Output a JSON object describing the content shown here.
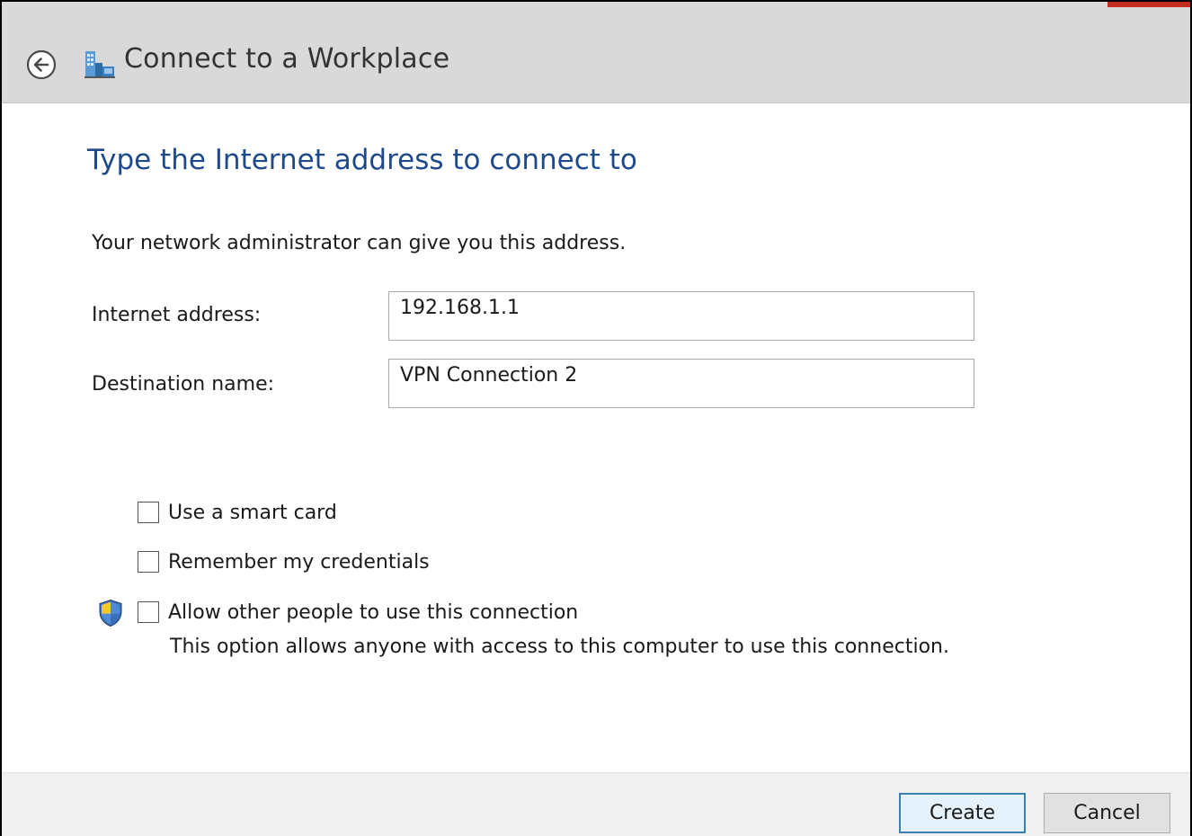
{
  "window": {
    "title": "Connect to a Workplace"
  },
  "page": {
    "heading": "Type the Internet address to connect to",
    "intro": "Your network administrator can give you this address."
  },
  "fields": {
    "internet_address": {
      "label": "Internet address:",
      "value": "192.168.1.1"
    },
    "destination_name": {
      "label": "Destination name:",
      "value": "VPN Connection 2"
    }
  },
  "options": {
    "smart_card": {
      "label": "Use a smart card",
      "checked": false
    },
    "remember_credentials": {
      "label": "Remember my credentials",
      "checked": false
    },
    "allow_others": {
      "label": "Allow other people to use this connection",
      "checked": false,
      "description": "This option allows anyone with access to this computer to use this connection."
    }
  },
  "footer": {
    "create_label": "Create",
    "cancel_label": "Cancel"
  },
  "icons": {
    "back": "back-arrow-icon",
    "app": "workplace-network-icon",
    "shield": "uac-shield-icon"
  },
  "colors": {
    "heading": "#1e4a8c",
    "titlebar": "#d9d9d9",
    "footer": "#f0f0f0",
    "primary_button_border": "#3c7fb1"
  }
}
